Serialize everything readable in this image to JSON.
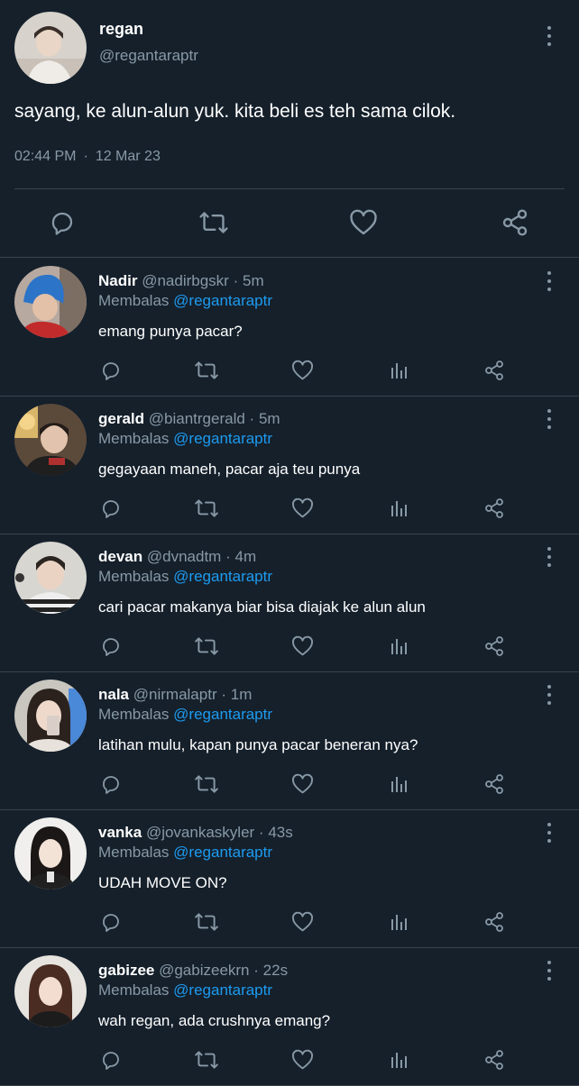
{
  "main_tweet": {
    "author_name": "regan",
    "author_handle": "@regantaraptr",
    "text": "sayang, ke alun-alun yuk. kita beli es teh sama cilok.",
    "time": "02:44 PM",
    "separator": "·",
    "date": "12 Mar 23"
  },
  "replies": [
    {
      "name": "Nadir",
      "handle": "@nadirbgskr",
      "sep": "·",
      "time": "5m",
      "replying_label": "Membalas",
      "mention": "@regantaraptr",
      "text": "emang punya pacar?"
    },
    {
      "name": "gerald",
      "handle": "@biantrgerald",
      "sep": "·",
      "time": "5m",
      "replying_label": "Membalas",
      "mention": "@regantaraptr",
      "text": "gegayaan maneh, pacar aja teu punya"
    },
    {
      "name": "devan",
      "handle": "@dvnadtm",
      "sep": "·",
      "time": "4m",
      "replying_label": "Membalas",
      "mention": "@regantaraptr",
      "text": "cari pacar makanya biar bisa diajak ke alun alun"
    },
    {
      "name": "nala",
      "handle": "@nirmalaptr",
      "sep": "·",
      "time": "1m",
      "replying_label": "Membalas",
      "mention": "@regantaraptr",
      "text": "latihan mulu, kapan punya pacar beneran nya?"
    },
    {
      "name": "vanka",
      "handle": "@jovankaskyler",
      "sep": "·",
      "time": "43s",
      "replying_label": "Membalas",
      "mention": "@regantaraptr",
      "text": "UDAH MOVE ON?"
    },
    {
      "name": "gabizee",
      "handle": "@gabizeekrn",
      "sep": "·",
      "time": "22s",
      "replying_label": "Membalas",
      "mention": "@regantaraptr",
      "text": "wah regan, ada crushnya emang?"
    }
  ],
  "colors": {
    "background": "#15202b",
    "text_primary": "#ffffff",
    "text_secondary": "#8899a6",
    "accent": "#1d9bf0",
    "border": "#38444d"
  },
  "icons": {
    "reply": "reply-icon",
    "retweet": "retweet-icon",
    "like": "heart-icon",
    "views": "views-icon",
    "share": "share-icon",
    "more": "more-icon"
  }
}
